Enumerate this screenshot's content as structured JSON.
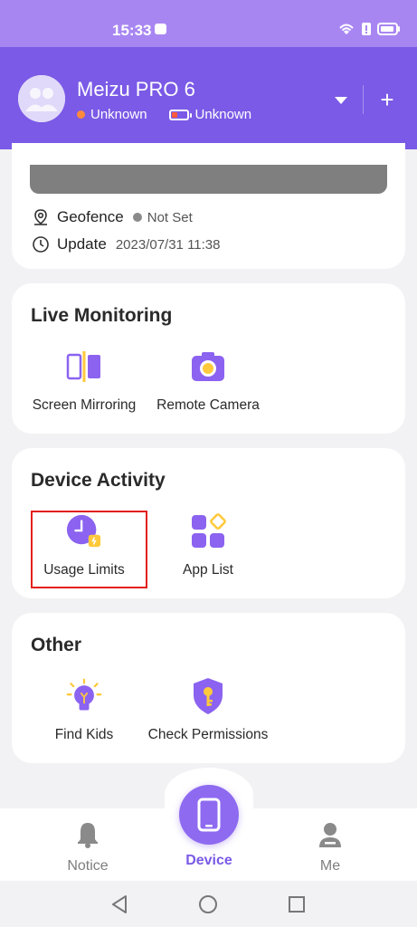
{
  "status_bar": {
    "time": "15:33"
  },
  "header": {
    "device_name": "Meizu PRO 6",
    "location_status": "Unknown",
    "battery_status": "Unknown",
    "add_label": "+"
  },
  "device_info": {
    "geofence_label": "Geofence",
    "geofence_value": "Not Set",
    "update_label": "Update",
    "update_value": "2023/07/31 11:38"
  },
  "live_monitoring": {
    "title": "Live Monitoring",
    "items": [
      {
        "label": "Screen Mirroring",
        "icon": "screen-mirroring-icon"
      },
      {
        "label": "Remote Camera",
        "icon": "camera-icon"
      }
    ]
  },
  "device_activity": {
    "title": "Device Activity",
    "items": [
      {
        "label": "Usage Limits",
        "icon": "clock-lock-icon"
      },
      {
        "label": "App List",
        "icon": "app-grid-icon"
      }
    ]
  },
  "other": {
    "title": "Other",
    "items": [
      {
        "label": "Find Kids",
        "icon": "lightbulb-icon"
      },
      {
        "label": "Check Permissions",
        "icon": "shield-key-icon"
      }
    ]
  },
  "bottom_nav": {
    "notice": "Notice",
    "device": "Device",
    "me": "Me"
  },
  "colors": {
    "accent": "#7a5ae6",
    "accent_light": "#a886f2",
    "icon_purple": "#8b63f0",
    "icon_yellow": "#ffc93c",
    "highlight_red": "#e2201b"
  }
}
